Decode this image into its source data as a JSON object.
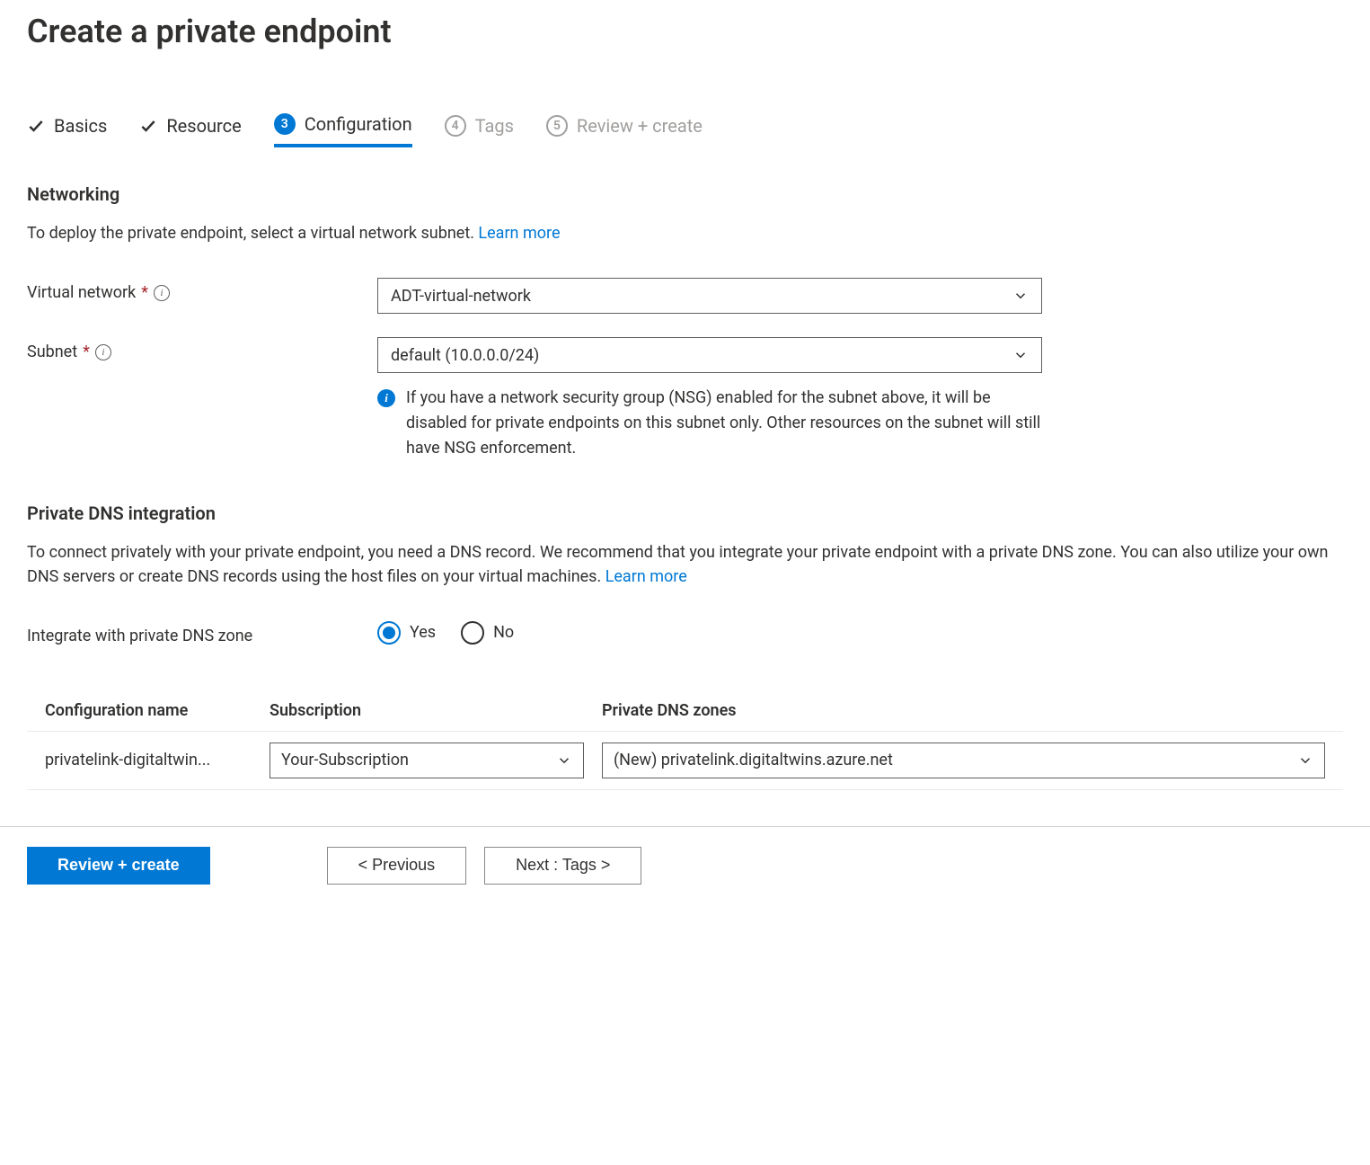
{
  "page": {
    "title": "Create a private endpoint"
  },
  "tabs": {
    "basics": "Basics",
    "resource": "Resource",
    "configuration": {
      "num": "3",
      "label": "Configuration"
    },
    "tags": {
      "num": "4",
      "label": "Tags"
    },
    "review": {
      "num": "5",
      "label": "Review + create"
    }
  },
  "networking": {
    "heading": "Networking",
    "desc": "To deploy the private endpoint, select a virtual network subnet.  ",
    "learn_more": "Learn more",
    "vnet_label": "Virtual network",
    "vnet_value": "ADT-virtual-network",
    "subnet_label": "Subnet",
    "subnet_value": "default (10.0.0.0/24)",
    "subnet_note": "If you have a network security group (NSG) enabled for the subnet above, it will be disabled for private endpoints on this subnet only. Other resources on the subnet will still have NSG enforcement."
  },
  "dns": {
    "heading": "Private DNS integration",
    "desc": "To connect privately with your private endpoint, you need a DNS record. We recommend that you integrate your private endpoint with a private DNS zone. You can also utilize your own DNS servers or create DNS records using the host files on your virtual machines.  ",
    "learn_more": "Learn more",
    "integrate_label": "Integrate with private DNS zone",
    "radio_yes": "Yes",
    "radio_no": "No",
    "table": {
      "col_config": "Configuration name",
      "col_sub": "Subscription",
      "col_zone": "Private DNS zones",
      "row": {
        "config_name": "privatelink-digitaltwin...",
        "subscription": "Your-Subscription",
        "zone": "(New) privatelink.digitaltwins.azure.net"
      }
    }
  },
  "footer": {
    "review": "Review + create",
    "previous": "< Previous",
    "next": "Next : Tags >"
  }
}
